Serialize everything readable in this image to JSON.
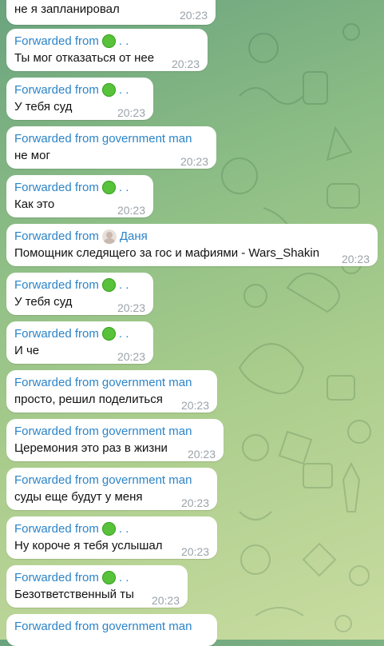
{
  "fwd_prefix": "Forwarded from",
  "messages": [
    {
      "from": "",
      "fromType": "none",
      "text": "не я запланировал",
      "time": "20:23"
    },
    {
      "from": ". .",
      "fromType": "dot",
      "text": "Ты мог отказаться от нее",
      "time": "20:23"
    },
    {
      "from": ". .",
      "fromType": "dot",
      "text": "У тебя суд",
      "time": "20:23"
    },
    {
      "from": "government man",
      "fromType": "text",
      "text": "не мог",
      "time": "20:23"
    },
    {
      "from": ". .",
      "fromType": "dot",
      "text": "Как это",
      "time": "20:23"
    },
    {
      "from": "Даня",
      "fromType": "avatar",
      "text": "Помощник следящего за гос и мафиями - Wars_Shakin",
      "time": "20:23"
    },
    {
      "from": ". .",
      "fromType": "dot",
      "text": "У тебя суд",
      "time": "20:23"
    },
    {
      "from": ". .",
      "fromType": "dot",
      "text": "И че",
      "time": "20:23"
    },
    {
      "from": "government man",
      "fromType": "text",
      "text": "просто, решил поделиться",
      "time": "20:23"
    },
    {
      "from": "government man",
      "fromType": "text",
      "text": "Церемония это раз в жизни",
      "time": "20:23"
    },
    {
      "from": "government man",
      "fromType": "text",
      "text": "суды еще будут у меня",
      "time": "20:23"
    },
    {
      "from": ". .",
      "fromType": "dot",
      "text": "Ну короче я тебя услышал",
      "time": "20:23"
    },
    {
      "from": ". .",
      "fromType": "dot",
      "text": "Безответственный ты",
      "time": "20:23"
    },
    {
      "from": "government man",
      "fromType": "text",
      "text": "",
      "time": ""
    }
  ]
}
